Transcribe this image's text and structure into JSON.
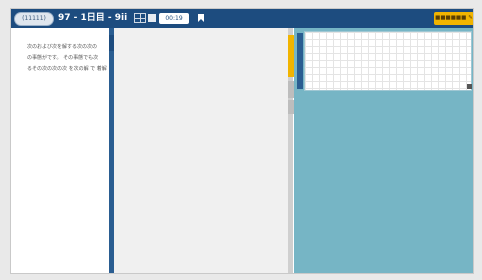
{
  "header": {
    "back_label": "(11111)",
    "title": "97 - 1日目 - 9ii",
    "timer": "00:19",
    "submit_label": "■■■■■■ ✎"
  },
  "passage": {
    "lines": [
      "次のおよび次を解する次の次の",
      "の事態がです。 その事態でも次",
      "るその次の次の次 を次の解 で 着解"
    ]
  }
}
